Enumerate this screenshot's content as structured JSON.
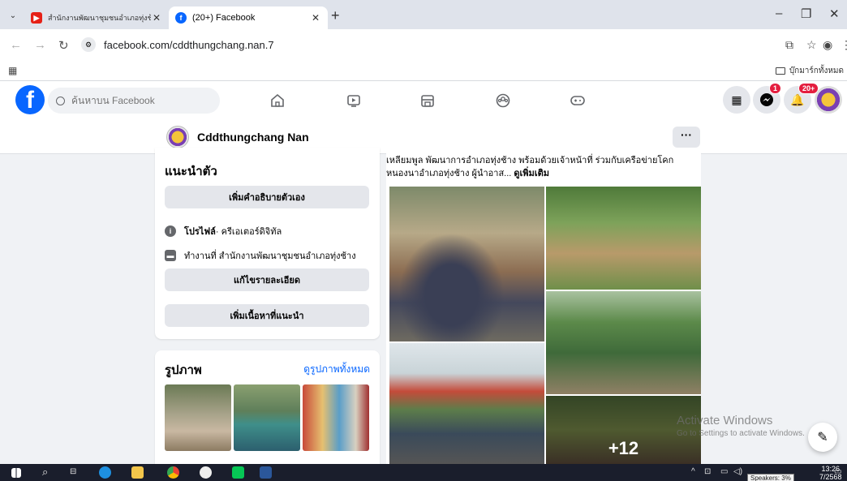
{
  "browser": {
    "tabs": [
      {
        "title": "สำนักงานพัฒนาชุมชนอำเภอทุ่งช้าง",
        "favicon_color": "#e62117"
      },
      {
        "title": "(20+) Facebook",
        "favicon_color": "#0866ff"
      }
    ],
    "url": "facebook.com/cddthungchang.nan.7",
    "bookmark_folder": "บุ๊กมาร์กทั้งหมด"
  },
  "fb": {
    "search_placeholder": "ค้นหาบน Facebook",
    "messenger_badge": "1",
    "notif_badge": "20+"
  },
  "page": {
    "name": "Cddthungchang Nan",
    "more": "···"
  },
  "intro": {
    "title": "แนะนำตัว",
    "add_bio": "เพิ่มคำอธิบายตัวเอง",
    "profile_label": "โปรไฟล์",
    "profile_type": " · ครีเอเตอร์ดิจิทัล",
    "work": "ทำงานที่ สำนักงานพัฒนาชุมชนอำเภอทุ่งช้าง",
    "edit_details": "แก้ไขรายละเอียด",
    "add_featured": "เพิ่มเนื้อหาที่แนะนำ"
  },
  "photos": {
    "title": "รูปภาพ",
    "see_all": "ดูรูปภาพทั้งหมด"
  },
  "post": {
    "text": "เหลียมพูล พัฒนาการอำเภอทุ่งช้าง พร้อมด้วยเจ้าหน้าที่ ร่วมกับเครือข่ายโคก หนองนาอำเภอทุ่งช้าง ผู้นำอาส... ",
    "see_more": "ดูเพิ่มเติม",
    "more_photos": "+12"
  },
  "windows": {
    "activate_title": "Activate Windows",
    "activate_sub": "Go to Settings to activate Windows.",
    "time": "13:26",
    "date": "7/2568",
    "tooltip": "Speakers: 3%"
  }
}
